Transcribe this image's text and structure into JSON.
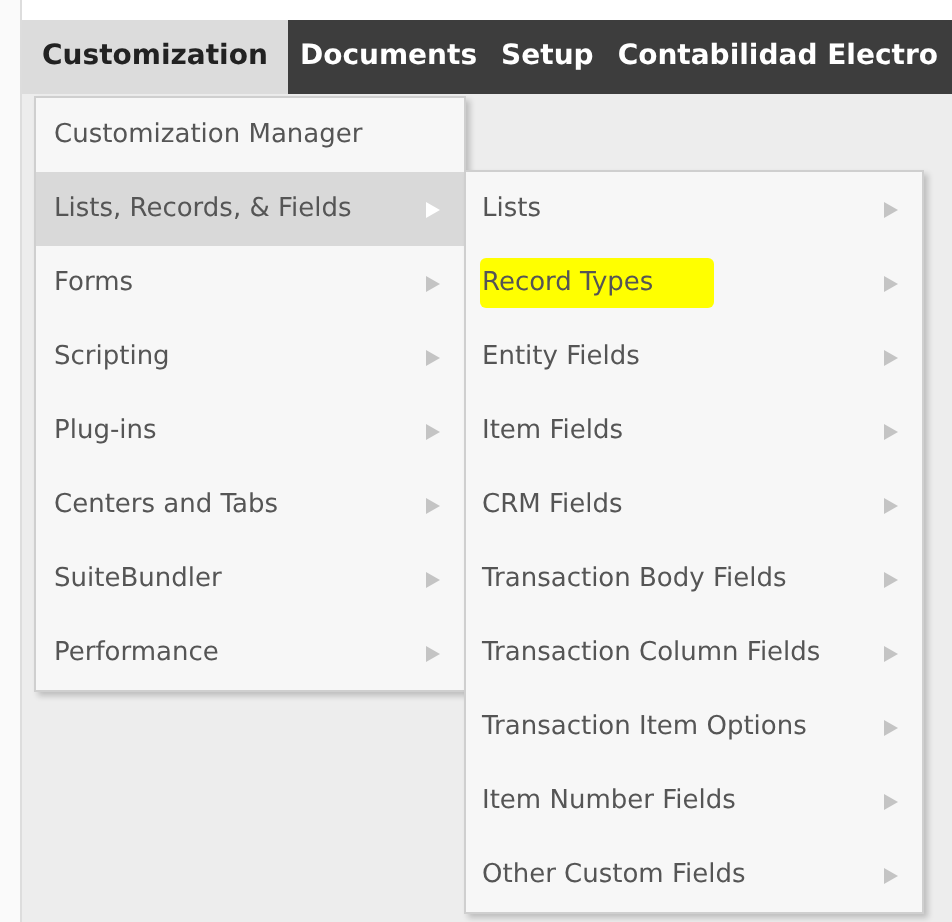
{
  "menubar": [
    {
      "label": "Customization",
      "selected": true
    },
    {
      "label": "Documents",
      "selected": false
    },
    {
      "label": "Setup",
      "selected": false
    },
    {
      "label": "Contabilidad Electro",
      "selected": false
    }
  ],
  "dropdown": [
    {
      "label": "Customization Manager",
      "selected": false,
      "has_submenu": false
    },
    {
      "label": "Lists, Records, & Fields",
      "selected": true,
      "has_submenu": true
    },
    {
      "label": "Forms",
      "selected": false,
      "has_submenu": true
    },
    {
      "label": "Scripting",
      "selected": false,
      "has_submenu": true
    },
    {
      "label": "Plug-ins",
      "selected": false,
      "has_submenu": true
    },
    {
      "label": "Centers and Tabs",
      "selected": false,
      "has_submenu": true
    },
    {
      "label": "SuiteBundler",
      "selected": false,
      "has_submenu": true
    },
    {
      "label": "Performance",
      "selected": false,
      "has_submenu": true
    }
  ],
  "submenu": [
    {
      "label": "Lists",
      "highlighted": false,
      "has_submenu": true
    },
    {
      "label": "Record Types",
      "highlighted": true,
      "has_submenu": true
    },
    {
      "label": "Entity Fields",
      "highlighted": false,
      "has_submenu": true
    },
    {
      "label": "Item Fields",
      "highlighted": false,
      "has_submenu": true
    },
    {
      "label": "CRM Fields",
      "highlighted": false,
      "has_submenu": true
    },
    {
      "label": "Transaction Body Fields",
      "highlighted": false,
      "has_submenu": true
    },
    {
      "label": "Transaction Column Fields",
      "highlighted": false,
      "has_submenu": true
    },
    {
      "label": "Transaction Item Options",
      "highlighted": false,
      "has_submenu": true
    },
    {
      "label": "Item Number Fields",
      "highlighted": false,
      "has_submenu": true
    },
    {
      "label": "Other Custom Fields",
      "highlighted": false,
      "has_submenu": true
    }
  ]
}
